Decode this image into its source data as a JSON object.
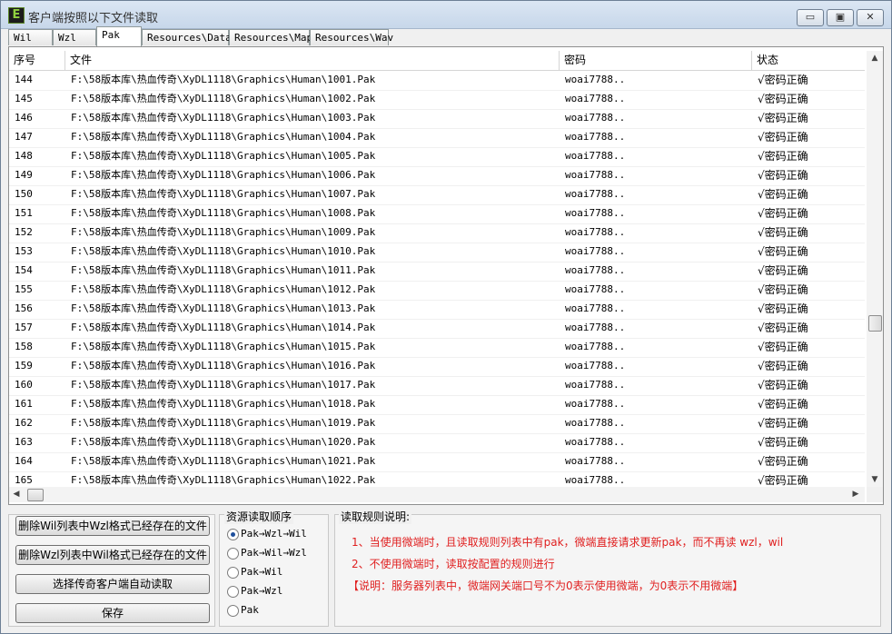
{
  "window": {
    "title": "客户端按照以下文件读取",
    "app_icon": "E",
    "minimize_glyph": "▭",
    "maximize_glyph": "▣",
    "close_glyph": "✕"
  },
  "tabs": [
    "Wil",
    "Wzl",
    "Pak",
    "Resources\\Data",
    "Resources\\Map",
    "Resources\\Wav"
  ],
  "active_tab": "Pak",
  "table": {
    "columns": [
      "序号",
      "文件",
      "密码",
      "状态"
    ],
    "rows": [
      {
        "no": "144",
        "file": "F:\\58版本库\\热血传奇\\XyDL1118\\Graphics\\Human\\1001.Pak",
        "password": "woai7788..",
        "status": "√密码正确"
      },
      {
        "no": "145",
        "file": "F:\\58版本库\\热血传奇\\XyDL1118\\Graphics\\Human\\1002.Pak",
        "password": "woai7788..",
        "status": "√密码正确"
      },
      {
        "no": "146",
        "file": "F:\\58版本库\\热血传奇\\XyDL1118\\Graphics\\Human\\1003.Pak",
        "password": "woai7788..",
        "status": "√密码正确"
      },
      {
        "no": "147",
        "file": "F:\\58版本库\\热血传奇\\XyDL1118\\Graphics\\Human\\1004.Pak",
        "password": "woai7788..",
        "status": "√密码正确"
      },
      {
        "no": "148",
        "file": "F:\\58版本库\\热血传奇\\XyDL1118\\Graphics\\Human\\1005.Pak",
        "password": "woai7788..",
        "status": "√密码正确"
      },
      {
        "no": "149",
        "file": "F:\\58版本库\\热血传奇\\XyDL1118\\Graphics\\Human\\1006.Pak",
        "password": "woai7788..",
        "status": "√密码正确"
      },
      {
        "no": "150",
        "file": "F:\\58版本库\\热血传奇\\XyDL1118\\Graphics\\Human\\1007.Pak",
        "password": "woai7788..",
        "status": "√密码正确"
      },
      {
        "no": "151",
        "file": "F:\\58版本库\\热血传奇\\XyDL1118\\Graphics\\Human\\1008.Pak",
        "password": "woai7788..",
        "status": "√密码正确"
      },
      {
        "no": "152",
        "file": "F:\\58版本库\\热血传奇\\XyDL1118\\Graphics\\Human\\1009.Pak",
        "password": "woai7788..",
        "status": "√密码正确"
      },
      {
        "no": "153",
        "file": "F:\\58版本库\\热血传奇\\XyDL1118\\Graphics\\Human\\1010.Pak",
        "password": "woai7788..",
        "status": "√密码正确"
      },
      {
        "no": "154",
        "file": "F:\\58版本库\\热血传奇\\XyDL1118\\Graphics\\Human\\1011.Pak",
        "password": "woai7788..",
        "status": "√密码正确"
      },
      {
        "no": "155",
        "file": "F:\\58版本库\\热血传奇\\XyDL1118\\Graphics\\Human\\1012.Pak",
        "password": "woai7788..",
        "status": "√密码正确"
      },
      {
        "no": "156",
        "file": "F:\\58版本库\\热血传奇\\XyDL1118\\Graphics\\Human\\1013.Pak",
        "password": "woai7788..",
        "status": "√密码正确"
      },
      {
        "no": "157",
        "file": "F:\\58版本库\\热血传奇\\XyDL1118\\Graphics\\Human\\1014.Pak",
        "password": "woai7788..",
        "status": "√密码正确"
      },
      {
        "no": "158",
        "file": "F:\\58版本库\\热血传奇\\XyDL1118\\Graphics\\Human\\1015.Pak",
        "password": "woai7788..",
        "status": "√密码正确"
      },
      {
        "no": "159",
        "file": "F:\\58版本库\\热血传奇\\XyDL1118\\Graphics\\Human\\1016.Pak",
        "password": "woai7788..",
        "status": "√密码正确"
      },
      {
        "no": "160",
        "file": "F:\\58版本库\\热血传奇\\XyDL1118\\Graphics\\Human\\1017.Pak",
        "password": "woai7788..",
        "status": "√密码正确"
      },
      {
        "no": "161",
        "file": "F:\\58版本库\\热血传奇\\XyDL1118\\Graphics\\Human\\1018.Pak",
        "password": "woai7788..",
        "status": "√密码正确"
      },
      {
        "no": "162",
        "file": "F:\\58版本库\\热血传奇\\XyDL1118\\Graphics\\Human\\1019.Pak",
        "password": "woai7788..",
        "status": "√密码正确"
      },
      {
        "no": "163",
        "file": "F:\\58版本库\\热血传奇\\XyDL1118\\Graphics\\Human\\1020.Pak",
        "password": "woai7788..",
        "status": "√密码正确"
      },
      {
        "no": "164",
        "file": "F:\\58版本库\\热血传奇\\XyDL1118\\Graphics\\Human\\1021.Pak",
        "password": "woai7788..",
        "status": "√密码正确"
      },
      {
        "no": "165",
        "file": "F:\\58版本库\\热血传奇\\XyDL1118\\Graphics\\Human\\1022.Pak",
        "password": "woai7788..",
        "status": "√密码正确"
      }
    ]
  },
  "buttons": {
    "delete_wil": "删除Wil列表中Wzl格式已经存在的文件",
    "delete_wzl": "删除Wzl列表中Wil格式已经存在的文件",
    "choose_client": "选择传奇客户端自动读取",
    "save": "保存"
  },
  "read_order": {
    "title": "资源读取顺序",
    "options": [
      "Pak→Wzl→Wil",
      "Pak→Wil→Wzl",
      "Pak→Wil",
      "Pak→Wzl",
      "Pak"
    ],
    "selected_index": 0
  },
  "rules": {
    "title": "读取规则说明:",
    "line1": "1、当使用微端时，且读取规则列表中有pak，微端直接请求更新pak，而不再读 wzl，wil",
    "line2": "2、不使用微端时，读取按配置的规则进行",
    "line3": "【说明：服务器列表中，微端网关端口号不为0表示使用微端，为0表示不用微端】"
  },
  "colors": {
    "rule_text": "#e02020",
    "radio_dot": "#1e4f9c"
  }
}
